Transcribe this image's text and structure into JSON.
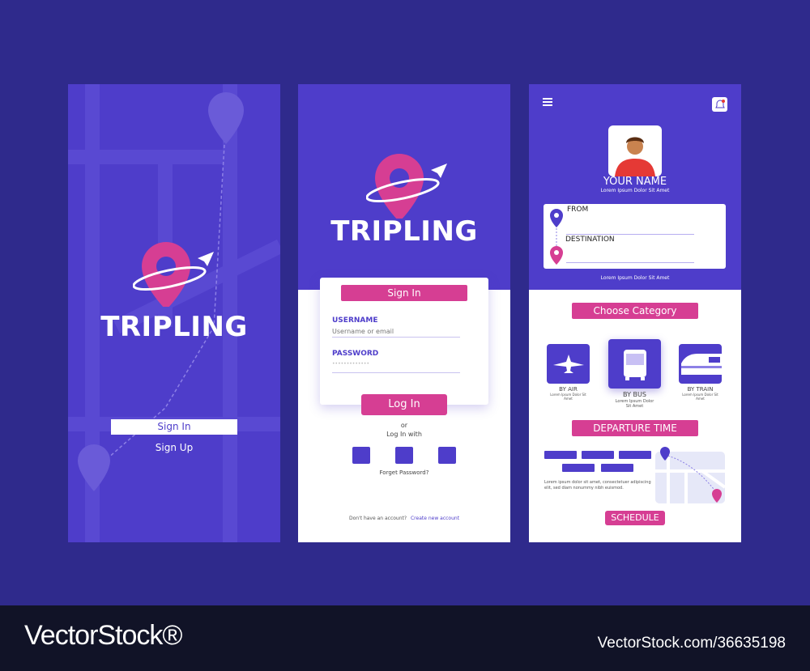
{
  "colors": {
    "background": "#2f2a8c",
    "primary": "#4e3dca",
    "accent": "#d63e93",
    "footer": "#111327"
  },
  "splash": {
    "brand": "TRIPLING",
    "sign_in": "Sign In",
    "sign_up": "Sign Up"
  },
  "login": {
    "brand": "TRIPLING",
    "card_title": "Sign In",
    "username_label": "USERNAME",
    "username_placeholder": "Username or email",
    "password_label": "PASSWORD",
    "password_value": "•••••••••••••",
    "login_button": "Log In",
    "or": "or",
    "login_with": "Log In with",
    "forgot": "Forget Password?",
    "no_account": "Don't have an account?",
    "create_account": "Create new account"
  },
  "home": {
    "menu_icon": "hamburger-icon",
    "bell_icon": "bell-icon",
    "name": "YOUR NAME",
    "subtitle": "Lorem Ipsum Dolor Sit Amet",
    "from_label": "FROM",
    "destination_label": "DESTINATION",
    "route_note": "Lorem Ipsum Dolor Sit Amet",
    "choose_category": "Choose Category",
    "categories": [
      {
        "label": "BY AIR",
        "desc": "Lorem Ipsum Dolor Sit Amet",
        "icon": "plane-icon"
      },
      {
        "label": "BY BUS",
        "desc": "Lorem Ipsum Dolor Sit Amet",
        "icon": "bus-icon",
        "selected": true
      },
      {
        "label": "BY TRAIN",
        "desc": "Lorem Ipsum Dolor Sit Amet",
        "icon": "train-icon"
      }
    ],
    "departure_time": "DEPARTURE TIME",
    "body": "Lorem ipsum dolor sit amet, consectetuer adipiscing elit, sed diam nonummy nibh euismod.",
    "schedule": "SCHEDULE"
  },
  "watermark": {
    "brand": "VectorStock®",
    "id": "VectorStock.com/36635198"
  }
}
